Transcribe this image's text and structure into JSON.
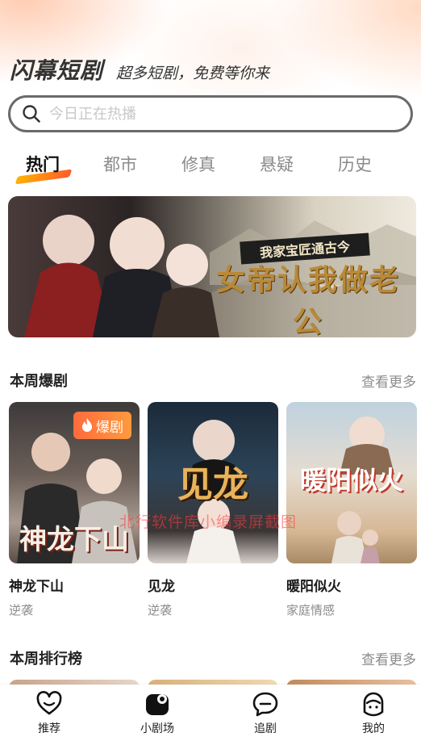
{
  "header": {
    "title": "闪幕短剧",
    "slogan": "超多短剧，免费等你来"
  },
  "search": {
    "placeholder": "今日正在热播"
  },
  "tabs": [
    {
      "label": "热门",
      "active": true
    },
    {
      "label": "都市",
      "active": false
    },
    {
      "label": "修真",
      "active": false
    },
    {
      "label": "悬疑",
      "active": false
    },
    {
      "label": "历史",
      "active": false
    }
  ],
  "banner": {
    "subtitle": "我家宝匠通古今",
    "title": "女帝认我做老公"
  },
  "weekly_hits": {
    "title": "本周爆剧",
    "more": "查看更多",
    "items": [
      {
        "name": "神龙下山",
        "genre": "逆袭",
        "badge": "爆剧",
        "poster_text": "神龙下山"
      },
      {
        "name": "见龙",
        "genre": "逆袭",
        "poster_text": "见龙"
      },
      {
        "name": "暖阳似火",
        "genre": "家庭情感",
        "poster_text": "暖阳似火"
      }
    ]
  },
  "weekly_rank": {
    "title": "本周排行榜",
    "more": "查看更多"
  },
  "watermark": "北行软件库小编录屏截图",
  "bottom_nav": [
    {
      "label": "推荐",
      "icon": "heart-face-icon"
    },
    {
      "label": "小剧场",
      "icon": "theater-icon"
    },
    {
      "label": "追剧",
      "icon": "chat-bubble-icon"
    },
    {
      "label": "我的",
      "icon": "profile-icon"
    }
  ],
  "colors": {
    "accent_gradient": [
      "#ffb300",
      "#ff5a2c"
    ],
    "badge": "#ff7a3d",
    "muted_text": "#8c8c8c"
  }
}
